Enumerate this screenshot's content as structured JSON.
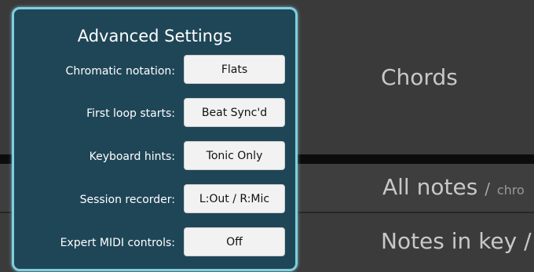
{
  "panel": {
    "title": "Advanced Settings",
    "settings": [
      {
        "label": "Chromatic notation:",
        "value": "Flats"
      },
      {
        "label": "First loop starts:",
        "value": "Beat Sync'd"
      },
      {
        "label": "Keyboard hints:",
        "value": "Tonic Only"
      },
      {
        "label": "Session recorder:",
        "value": "L:Out / R:Mic"
      },
      {
        "label": "Expert MIDI controls:",
        "value": "Off"
      }
    ]
  },
  "background": {
    "chords_label": "Chords",
    "all_notes_label": "All notes",
    "all_notes_separator": "/",
    "all_notes_sub": "chro",
    "notes_in_key_label": "Notes in key /"
  },
  "colors": {
    "panel_bg": "#1f4657",
    "panel_border": "#7ecfdf",
    "button_bg": "#f2f2f2"
  }
}
